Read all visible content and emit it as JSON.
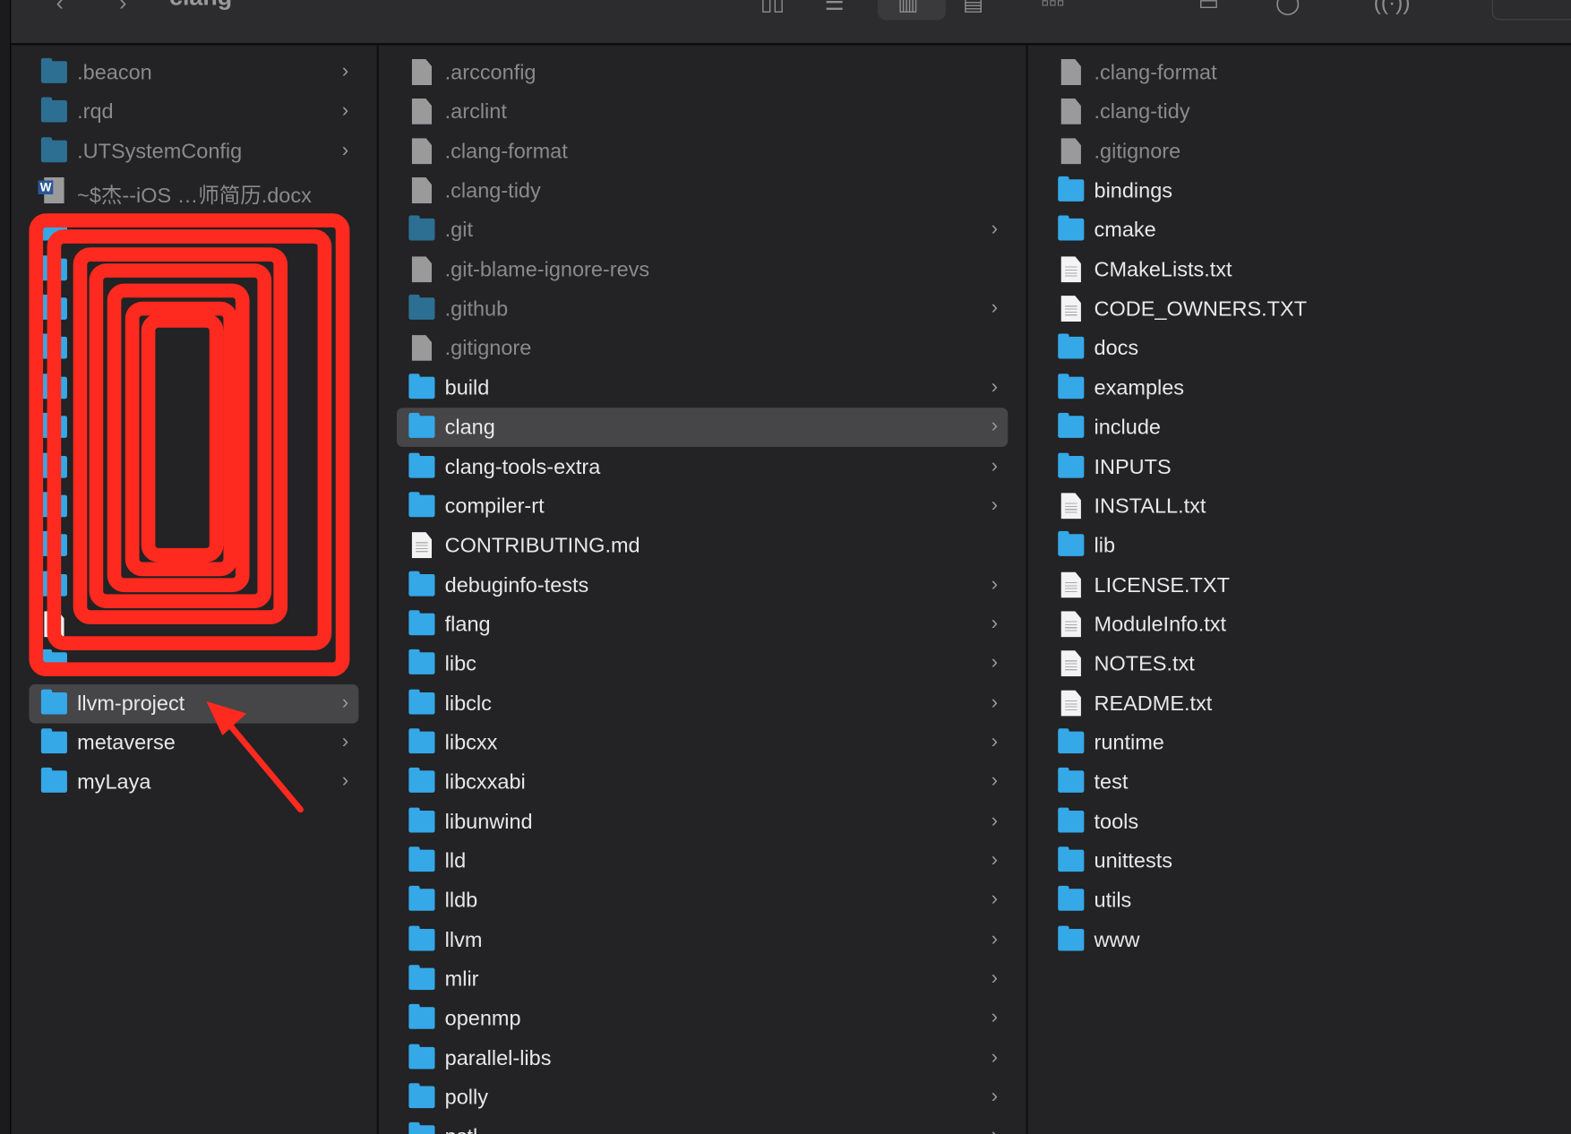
{
  "toolbar": {
    "title": "clang",
    "back_icon": "chevron-left-icon",
    "forward_icon": "chevron-right-icon"
  },
  "colors": {
    "folder": "#35a8e8",
    "selection": "#464547",
    "annotation": "#ff2a1f"
  },
  "columns": [
    {
      "items": [
        {
          "label": ".beacon",
          "type": "folder",
          "dim": true,
          "chevron": true
        },
        {
          "label": ".rqd",
          "type": "folder",
          "dim": true,
          "chevron": true
        },
        {
          "label": ".UTSystemConfig",
          "type": "folder",
          "dim": true,
          "chevron": true
        },
        {
          "label": "~$杰--iOS …师简历.docx",
          "type": "word",
          "dim": true,
          "chevron": false
        },
        {
          "label": "",
          "type": "folder",
          "chevron": false
        },
        {
          "label": "",
          "type": "folder",
          "chevron": false
        },
        {
          "label": "",
          "type": "folder",
          "chevron": false
        },
        {
          "label": "",
          "type": "folder",
          "chevron": false
        },
        {
          "label": "",
          "type": "folder",
          "chevron": false
        },
        {
          "label": "",
          "type": "folder",
          "chevron": false
        },
        {
          "label": "",
          "type": "folder",
          "chevron": false
        },
        {
          "label": "",
          "type": "folder",
          "chevron": false
        },
        {
          "label": "",
          "type": "folder",
          "chevron": false
        },
        {
          "label": "",
          "type": "folder",
          "chevron": false
        },
        {
          "label": "",
          "type": "file",
          "chevron": false
        },
        {
          "label": "",
          "type": "folder",
          "chevron": false
        },
        {
          "label": "llvm-project",
          "type": "folder",
          "chevron": true,
          "selected": true
        },
        {
          "label": "metaverse",
          "type": "folder",
          "chevron": true
        },
        {
          "label": "myLaya",
          "type": "folder",
          "chevron": true
        }
      ]
    },
    {
      "items": [
        {
          "label": ".arcconfig",
          "type": "file",
          "dim": true
        },
        {
          "label": ".arclint",
          "type": "file",
          "dim": true
        },
        {
          "label": ".clang-format",
          "type": "file",
          "dim": true
        },
        {
          "label": ".clang-tidy",
          "type": "file",
          "dim": true
        },
        {
          "label": ".git",
          "type": "folder",
          "dim": true,
          "chevron": true
        },
        {
          "label": ".git-blame-ignore-revs",
          "type": "file",
          "dim": true
        },
        {
          "label": ".github",
          "type": "folder",
          "dim": true,
          "chevron": true
        },
        {
          "label": ".gitignore",
          "type": "file",
          "dim": true
        },
        {
          "label": "build",
          "type": "folder",
          "chevron": true
        },
        {
          "label": "clang",
          "type": "folder",
          "chevron": true,
          "selected": true
        },
        {
          "label": "clang-tools-extra",
          "type": "folder",
          "chevron": true
        },
        {
          "label": "compiler-rt",
          "type": "folder",
          "chevron": true
        },
        {
          "label": "CONTRIBUTING.md",
          "type": "file"
        },
        {
          "label": "debuginfo-tests",
          "type": "folder",
          "chevron": true
        },
        {
          "label": "flang",
          "type": "folder",
          "chevron": true
        },
        {
          "label": "libc",
          "type": "folder",
          "chevron": true
        },
        {
          "label": "libclc",
          "type": "folder",
          "chevron": true
        },
        {
          "label": "libcxx",
          "type": "folder",
          "chevron": true
        },
        {
          "label": "libcxxabi",
          "type": "folder",
          "chevron": true
        },
        {
          "label": "libunwind",
          "type": "folder",
          "chevron": true
        },
        {
          "label": "lld",
          "type": "folder",
          "chevron": true
        },
        {
          "label": "lldb",
          "type": "folder",
          "chevron": true
        },
        {
          "label": "llvm",
          "type": "folder",
          "chevron": true
        },
        {
          "label": "mlir",
          "type": "folder",
          "chevron": true
        },
        {
          "label": "openmp",
          "type": "folder",
          "chevron": true
        },
        {
          "label": "parallel-libs",
          "type": "folder",
          "chevron": true
        },
        {
          "label": "polly",
          "type": "folder",
          "chevron": true
        },
        {
          "label": "pstl",
          "type": "folder",
          "chevron": true
        }
      ]
    },
    {
      "items": [
        {
          "label": ".clang-format",
          "type": "file",
          "dim": true
        },
        {
          "label": ".clang-tidy",
          "type": "file",
          "dim": true
        },
        {
          "label": ".gitignore",
          "type": "file",
          "dim": true
        },
        {
          "label": "bindings",
          "type": "folder"
        },
        {
          "label": "cmake",
          "type": "folder"
        },
        {
          "label": "CMakeLists.txt",
          "type": "file"
        },
        {
          "label": "CODE_OWNERS.TXT",
          "type": "file"
        },
        {
          "label": "docs",
          "type": "folder"
        },
        {
          "label": "examples",
          "type": "folder"
        },
        {
          "label": "include",
          "type": "folder"
        },
        {
          "label": "INPUTS",
          "type": "folder"
        },
        {
          "label": "INSTALL.txt",
          "type": "file"
        },
        {
          "label": "lib",
          "type": "folder"
        },
        {
          "label": "LICENSE.TXT",
          "type": "file"
        },
        {
          "label": "ModuleInfo.txt",
          "type": "file"
        },
        {
          "label": "NOTES.txt",
          "type": "file"
        },
        {
          "label": "README.txt",
          "type": "file"
        },
        {
          "label": "runtime",
          "type": "folder"
        },
        {
          "label": "test",
          "type": "folder"
        },
        {
          "label": "tools",
          "type": "folder"
        },
        {
          "label": "unittests",
          "type": "folder"
        },
        {
          "label": "utils",
          "type": "folder"
        },
        {
          "label": "www",
          "type": "folder"
        }
      ]
    }
  ]
}
